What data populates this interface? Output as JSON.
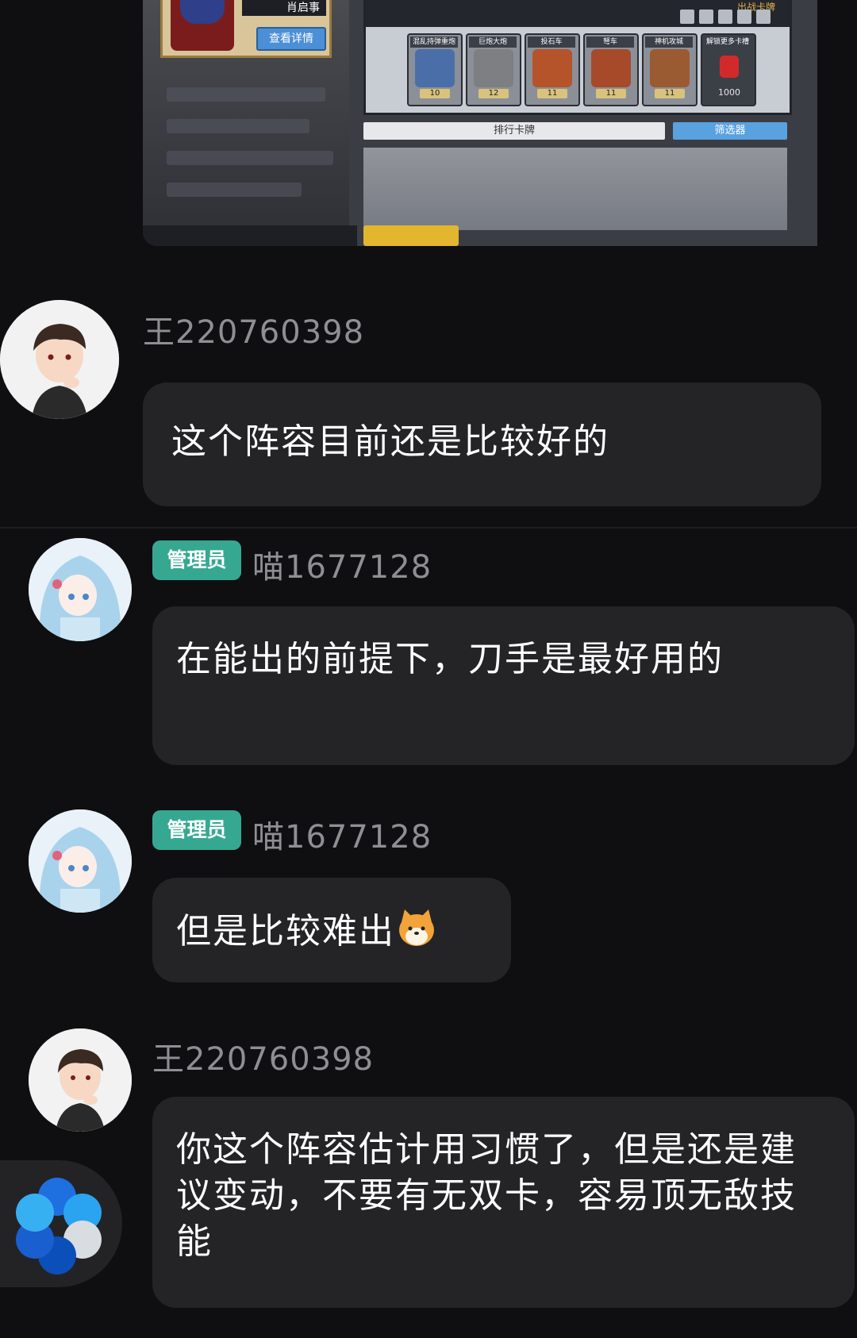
{
  "game_screenshot": {
    "hero_name": "肖启事",
    "detail_button": "查看详情",
    "title_right": "出战卡牌",
    "slots": [
      {
        "label": "混乱持弹重炮",
        "level": "10",
        "color": "#4a6fa8"
      },
      {
        "label": "巨炮大炮",
        "level": "12",
        "color": "#7e7f82"
      },
      {
        "label": "投石车",
        "level": "11",
        "color": "#b5532b"
      },
      {
        "label": "弩车",
        "level": "11",
        "color": "#a64a2a"
      },
      {
        "label": "神机攻城",
        "level": "11",
        "color": "#9a5a32"
      }
    ],
    "locked_slot": {
      "label": "解锁更多卡槽",
      "cost": "1000"
    },
    "card_bar": "排行卡牌",
    "filter_button": "筛选器"
  },
  "messages": [
    {
      "id": "m1",
      "user": "王220760398",
      "text": "这个阵容目前还是比较好的",
      "avatar": "male-avatar"
    },
    {
      "id": "m2",
      "user": "喵1677128",
      "badge": "管理员",
      "text": "在能出的前提下，刀手是最好用的",
      "avatar": "anime-girl-avatar"
    },
    {
      "id": "m3",
      "user": "喵1677128",
      "badge": "管理员",
      "text": "但是比较难出",
      "emoji": "shiba-dog-emoji",
      "avatar": "anime-girl-avatar"
    },
    {
      "id": "m4",
      "user": "王220760398",
      "text": "你这个阵容估计用习惯了，但是还是建议变动，不要有无双卡，容易顶无敌技能",
      "avatar": "male-avatar"
    }
  ],
  "colors": {
    "background": "#0f0f11",
    "bubble": "#242427",
    "badge": "#36a892",
    "username": "#8e8e93"
  }
}
